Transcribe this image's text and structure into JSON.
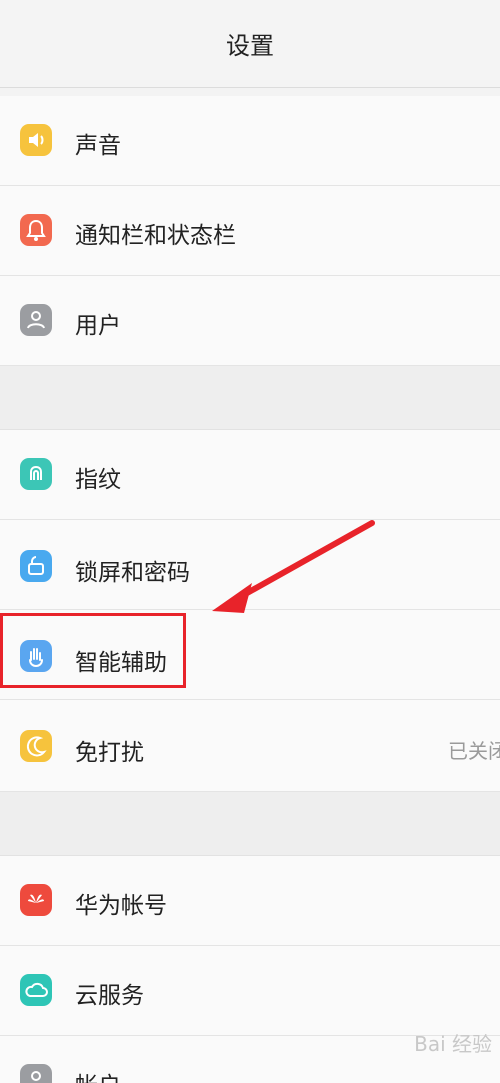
{
  "header": {
    "title": "设置"
  },
  "rows": {
    "sound": {
      "label": "声音",
      "icon": "speaker-icon",
      "color": "#f6c33d"
    },
    "notifications": {
      "label": "通知栏和状态栏",
      "icon": "bell-icon",
      "color": "#f2694f"
    },
    "users": {
      "label": "用户",
      "icon": "user-icon",
      "color": "#9b9da1"
    },
    "fingerprint": {
      "label": "指纹",
      "icon": "fingerprint-icon",
      "color": "#3cc6b6"
    },
    "lockscreen": {
      "label": "锁屏和密码",
      "icon": "lock-icon",
      "color": "#49a9ef"
    },
    "smart_assist": {
      "label": "智能辅助",
      "icon": "hand-icon",
      "color": "#5aa6f0"
    },
    "do_not_disturb": {
      "label": "免打扰",
      "value": "已关闭",
      "icon": "moon-icon",
      "color": "#f6c33d"
    },
    "huawei_account": {
      "label": "华为帐号",
      "icon": "huawei-logo-icon",
      "color": "#ee4a3d"
    },
    "cloud": {
      "label": "云服务",
      "icon": "cloud-icon",
      "color": "#2ec5b6"
    },
    "accounts": {
      "label": "帐户",
      "icon": "account-icon",
      "color": "#9b9da1"
    }
  },
  "watermark": {
    "text": "Bai 经验"
  }
}
